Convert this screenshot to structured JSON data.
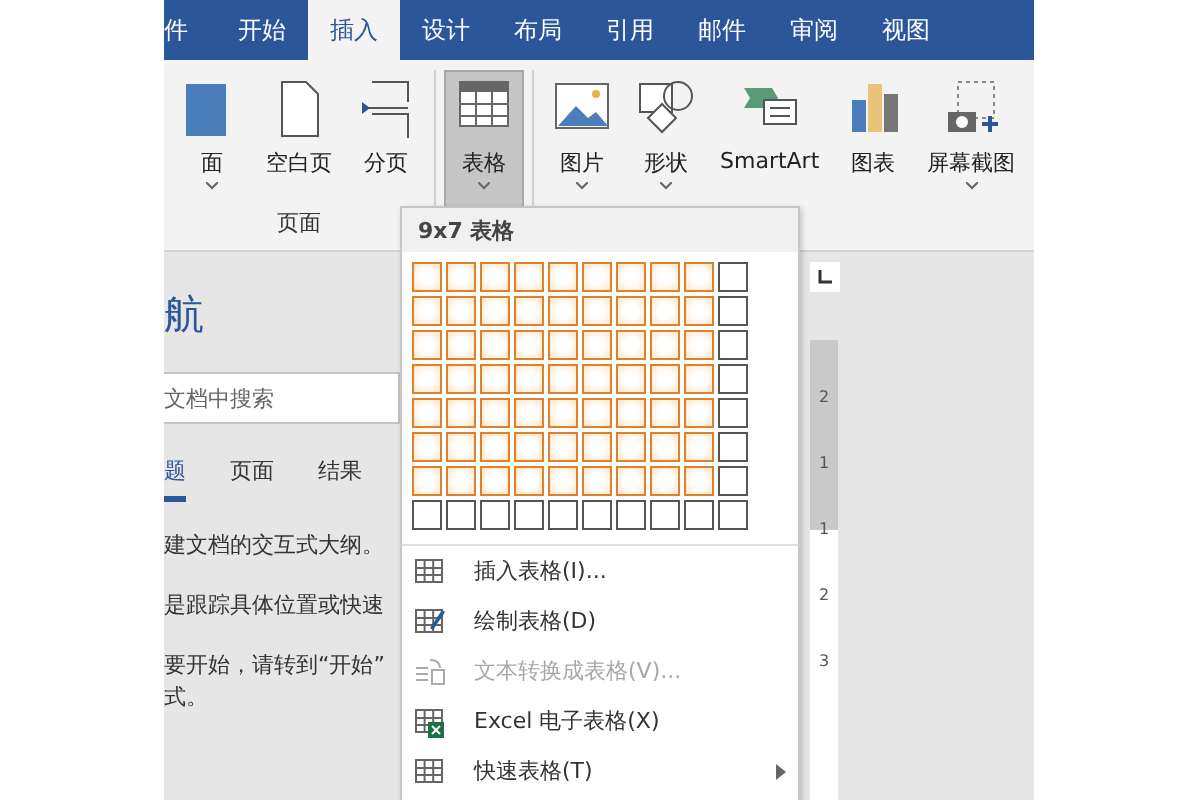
{
  "ribbon_tabs": [
    {
      "label": "件",
      "selected": false
    },
    {
      "label": "开始",
      "selected": false
    },
    {
      "label": "插入",
      "selected": true
    },
    {
      "label": "设计",
      "selected": false
    },
    {
      "label": "布局",
      "selected": false
    },
    {
      "label": "引用",
      "selected": false
    },
    {
      "label": "邮件",
      "selected": false
    },
    {
      "label": "审阅",
      "selected": false
    },
    {
      "label": "视图",
      "selected": false
    }
  ],
  "ribbon_groups": [
    {
      "label": "页面",
      "buttons": [
        {
          "kind": "cover",
          "label": "面",
          "dropdown": true,
          "pressed": false
        },
        {
          "kind": "blank",
          "label": "空白页",
          "dropdown": false,
          "pressed": false
        },
        {
          "kind": "break",
          "label": "分页",
          "dropdown": false,
          "pressed": false
        }
      ]
    },
    {
      "buttons": [
        {
          "kind": "table",
          "label": "表格",
          "dropdown": true,
          "pressed": true
        }
      ]
    },
    {
      "buttons": [
        {
          "kind": "picture",
          "label": "图片",
          "dropdown": true,
          "pressed": false
        },
        {
          "kind": "shapes",
          "label": "形状",
          "dropdown": true,
          "pressed": false
        },
        {
          "kind": "smartart",
          "label": "SmartArt",
          "dropdown": false,
          "pressed": false
        },
        {
          "kind": "chart",
          "label": "图表",
          "dropdown": false,
          "pressed": false
        },
        {
          "kind": "screenshot",
          "label": "屏幕截图",
          "dropdown": true,
          "pressed": false
        }
      ]
    }
  ],
  "navigation": {
    "title": "航",
    "search": {
      "placeholder": "文档中搜索"
    },
    "tabs": [
      {
        "label": "题",
        "selected": true
      },
      {
        "label": "页面",
        "selected": false
      },
      {
        "label": "结果",
        "selected": false
      }
    ],
    "paragraphs": [
      {
        "lines": [
          "建文档的交互式大纲。"
        ]
      },
      {
        "lines": [
          "是跟踪具体位置或快速"
        ]
      },
      {
        "lines": [
          "要开始，请转到“开始”",
          "式。"
        ]
      }
    ]
  },
  "ruler": {
    "labels": [
      "2",
      "1",
      "1",
      "2",
      "3"
    ]
  },
  "table_menu": {
    "title": "9x7 表格",
    "grid": [
      {
        "cells": [
          {
            "selected": true
          },
          {
            "selected": true
          },
          {
            "selected": true
          },
          {
            "selected": true
          },
          {
            "selected": true
          },
          {
            "selected": true
          },
          {
            "selected": true
          },
          {
            "selected": true
          },
          {
            "selected": true
          },
          {
            "selected": false
          }
        ]
      },
      {
        "cells": [
          {
            "selected": true
          },
          {
            "selected": true
          },
          {
            "selected": true
          },
          {
            "selected": true
          },
          {
            "selected": true
          },
          {
            "selected": true
          },
          {
            "selected": true
          },
          {
            "selected": true
          },
          {
            "selected": true
          },
          {
            "selected": false
          }
        ]
      },
      {
        "cells": [
          {
            "selected": true
          },
          {
            "selected": true
          },
          {
            "selected": true
          },
          {
            "selected": true
          },
          {
            "selected": true
          },
          {
            "selected": true
          },
          {
            "selected": true
          },
          {
            "selected": true
          },
          {
            "selected": true
          },
          {
            "selected": false
          }
        ]
      },
      {
        "cells": [
          {
            "selected": true
          },
          {
            "selected": true
          },
          {
            "selected": true
          },
          {
            "selected": true
          },
          {
            "selected": true
          },
          {
            "selected": true
          },
          {
            "selected": true
          },
          {
            "selected": true
          },
          {
            "selected": true
          },
          {
            "selected": false
          }
        ]
      },
      {
        "cells": [
          {
            "selected": true
          },
          {
            "selected": true
          },
          {
            "selected": true
          },
          {
            "selected": true
          },
          {
            "selected": true
          },
          {
            "selected": true
          },
          {
            "selected": true
          },
          {
            "selected": true
          },
          {
            "selected": true
          },
          {
            "selected": false
          }
        ]
      },
      {
        "cells": [
          {
            "selected": true
          },
          {
            "selected": true
          },
          {
            "selected": true
          },
          {
            "selected": true
          },
          {
            "selected": true
          },
          {
            "selected": true
          },
          {
            "selected": true
          },
          {
            "selected": true
          },
          {
            "selected": true
          },
          {
            "selected": false
          }
        ]
      },
      {
        "cells": [
          {
            "selected": true
          },
          {
            "selected": true
          },
          {
            "selected": true
          },
          {
            "selected": true
          },
          {
            "selected": true
          },
          {
            "selected": true
          },
          {
            "selected": true
          },
          {
            "selected": true
          },
          {
            "selected": true
          },
          {
            "selected": false
          }
        ]
      },
      {
        "cells": [
          {
            "selected": false
          },
          {
            "selected": false
          },
          {
            "selected": false
          },
          {
            "selected": false
          },
          {
            "selected": false
          },
          {
            "selected": false
          },
          {
            "selected": false
          },
          {
            "selected": false
          },
          {
            "selected": false
          },
          {
            "selected": false
          }
        ]
      }
    ],
    "items": [
      {
        "kind": "insert",
        "label": "插入表格(I)...",
        "disabled": false,
        "submenu": false
      },
      {
        "kind": "draw",
        "label": "绘制表格(D)",
        "disabled": false,
        "submenu": false
      },
      {
        "kind": "convert",
        "label": "文本转换成表格(V)...",
        "disabled": true,
        "submenu": false
      },
      {
        "kind": "excel",
        "label": "Excel 电子表格(X)",
        "disabled": false,
        "submenu": false
      },
      {
        "kind": "quick",
        "label": "快速表格(T)",
        "disabled": false,
        "submenu": true
      }
    ]
  }
}
